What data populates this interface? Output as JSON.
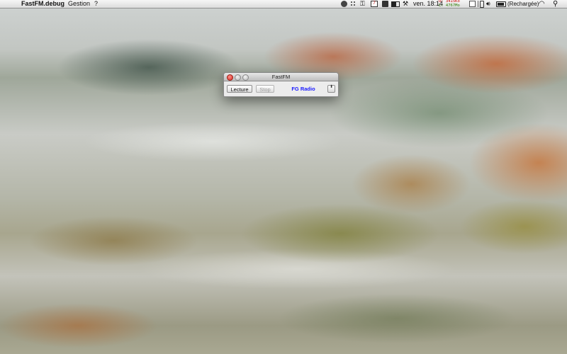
{
  "menubar": {
    "apple_glyph": "",
    "app_name": "FastFM.debug",
    "menus": [
      "Gestion",
      "?"
    ],
    "calendar_day": "7",
    "network": {
      "up": "U: 3415Ko",
      "down": "L: 4767Mo"
    },
    "clock": "ven. 18:14",
    "battery_status": "(Rechargée)",
    "status_icons": [
      "status-circle-icon",
      "dots-icon",
      "lock-icon",
      "calendar-icon",
      "camera-icon",
      "battery-small-icon",
      "wrench-icon",
      "document-icon",
      "phone-icon",
      "volume-icon",
      "battery-icon",
      "wifi-icon",
      "spotlight-icon"
    ]
  },
  "window": {
    "title": "FastFM",
    "play_label": "Lecture",
    "stop_label": "Stop",
    "station": "FG Radio",
    "station_color": "#1a1aff",
    "dropdown_glyph": "⬍"
  },
  "colors": {
    "close_button": "#e0443a",
    "stop_disabled_text": "#9a9a9a"
  }
}
